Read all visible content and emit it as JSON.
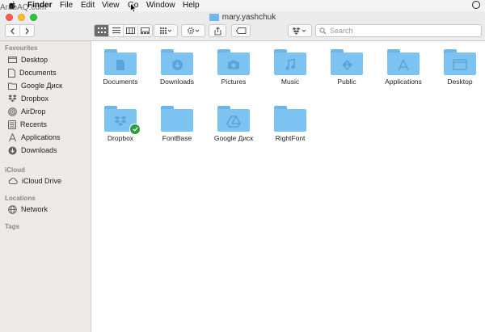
{
  "menubar": {
    "items": [
      "Finder",
      "File",
      "Edit",
      "View",
      "Go",
      "Window",
      "Help"
    ],
    "watermark": "ArabAQ.com"
  },
  "window": {
    "title": "mary.yashchuk"
  },
  "toolbar": {
    "search_placeholder": "Search"
  },
  "sidebar": {
    "sections": [
      {
        "title": "Favourites",
        "items": [
          "Desktop",
          "Documents",
          "Google Диск",
          "Dropbox",
          "AirDrop",
          "Recents",
          "Applications",
          "Downloads"
        ]
      },
      {
        "title": "iCloud",
        "items": [
          "iCloud Drive"
        ]
      },
      {
        "title": "Locations",
        "items": [
          "Network"
        ]
      },
      {
        "title": "Tags",
        "items": []
      }
    ]
  },
  "files": [
    {
      "name": "Documents",
      "icon": "document-icon"
    },
    {
      "name": "Downloads",
      "icon": "download-icon"
    },
    {
      "name": "Pictures",
      "icon": "camera-icon"
    },
    {
      "name": "Music",
      "icon": "music-note-icon"
    },
    {
      "name": "Public",
      "icon": "public-icon"
    },
    {
      "name": "Applications",
      "icon": "applications-icon"
    },
    {
      "name": "Desktop",
      "icon": "desktop-icon"
    },
    {
      "name": "Dropbox",
      "icon": "dropbox-icon"
    },
    {
      "name": "FontBase",
      "icon": "folder-icon"
    },
    {
      "name": "Google Диск",
      "icon": "google-drive-icon"
    },
    {
      "name": "RightFont",
      "icon": "folder-icon"
    }
  ],
  "colors": {
    "folder": "#7cc3f2",
    "sidebar": "#ece9e6",
    "sync_badge": "#2d9c3f"
  }
}
